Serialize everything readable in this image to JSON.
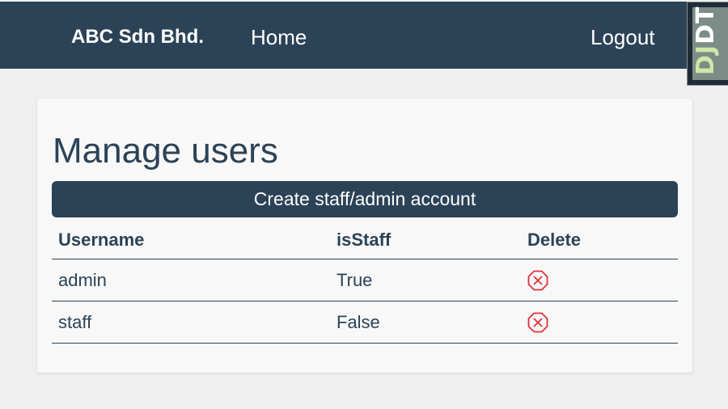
{
  "navbar": {
    "brand": "ABC Sdn Bhd.",
    "home_label": "Home",
    "logout_label": "Logout"
  },
  "debug_toolbar": {
    "label_prefix": "DJ",
    "label_suffix": "DT"
  },
  "main": {
    "title": "Manage users",
    "create_button_label": "Create staff/admin account",
    "table": {
      "headers": [
        "Username",
        "isStaff",
        "Delete"
      ],
      "rows": [
        {
          "username": "admin",
          "is_staff": "True",
          "delete_icon": "delete-icon"
        },
        {
          "username": "staff",
          "is_staff": "False",
          "delete_icon": "delete-icon"
        }
      ]
    }
  },
  "colors": {
    "primary": "#2c4357",
    "background": "#efefef",
    "card": "#f8f8f8",
    "danger": "#e0303a"
  }
}
